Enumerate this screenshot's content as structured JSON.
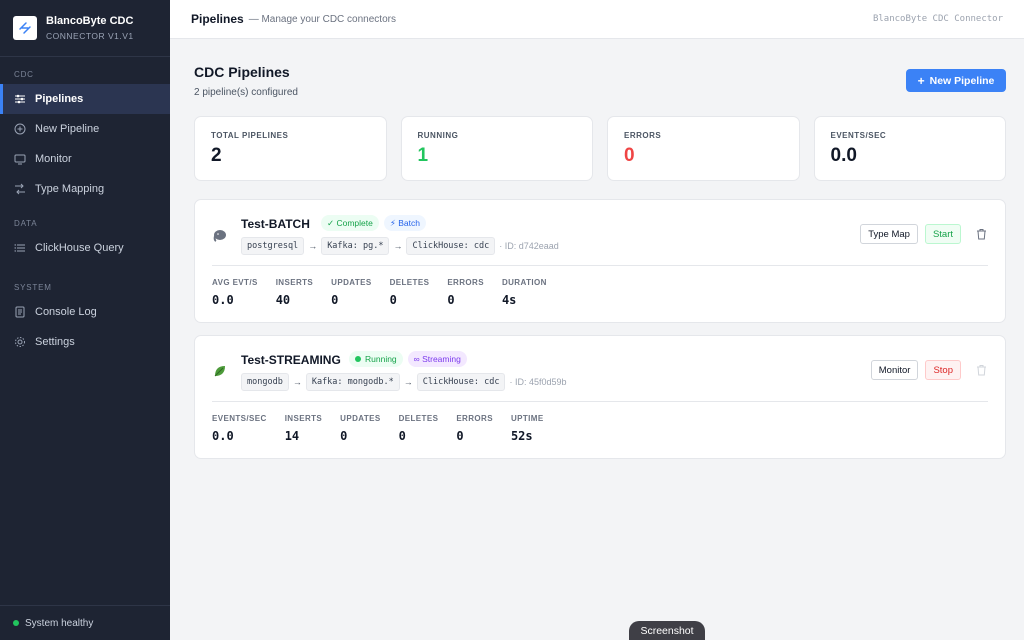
{
  "sidebar": {
    "brand_name": "BlancoByte CDC",
    "brand_version": "CONNECTOR V1.V1",
    "sections": [
      {
        "label": "CDC",
        "items": [
          {
            "label": "Pipelines",
            "icon": "sliders-icon"
          },
          {
            "label": "New Pipeline",
            "icon": "plus-circle-icon"
          },
          {
            "label": "Monitor",
            "icon": "monitor-icon"
          },
          {
            "label": "Type Mapping",
            "icon": "shuffle-icon"
          }
        ]
      },
      {
        "label": "DATA",
        "items": [
          {
            "label": "ClickHouse Query",
            "icon": "list-icon"
          }
        ]
      },
      {
        "label": "SYSTEM",
        "items": [
          {
            "label": "Console Log",
            "icon": "file-icon"
          },
          {
            "label": "Settings",
            "icon": "gear-icon"
          }
        ]
      }
    ],
    "status": "System healthy"
  },
  "topbar": {
    "title": "Pipelines",
    "subtitle": "— Manage your CDC connectors",
    "right": "BlancoByte CDC Connector"
  },
  "main": {
    "title": "CDC Pipelines",
    "subtitle": "2 pipeline(s) configured",
    "new_button": "New Pipeline",
    "stats": [
      {
        "label": "TOTAL PIPELINES",
        "value": "2",
        "color": "#111827"
      },
      {
        "label": "RUNNING",
        "value": "1",
        "color": "#22c55e"
      },
      {
        "label": "ERRORS",
        "value": "0",
        "color": "#ef4444"
      },
      {
        "label": "EVENTS/SEC",
        "value": "0.0",
        "color": "#111827"
      }
    ]
  },
  "pipelines": [
    {
      "name": "Test-BATCH",
      "icon": "elephant-icon",
      "badge_status": "✓ Complete",
      "badge_mode": "⚡ Batch",
      "source": "postgresql",
      "topic": "Kafka: pg.*",
      "sink": "ClickHouse: cdc",
      "id_text": "· ID: d742eaad",
      "btn_primary": "Type Map",
      "btn_secondary": "Start",
      "metrics": [
        {
          "label": "AVG EVT/S",
          "value": "0.0"
        },
        {
          "label": "INSERTS",
          "value": "40"
        },
        {
          "label": "UPDATES",
          "value": "0"
        },
        {
          "label": "DELETES",
          "value": "0"
        },
        {
          "label": "ERRORS",
          "value": "0"
        },
        {
          "label": "DURATION",
          "value": "4s"
        }
      ]
    },
    {
      "name": "Test-STREAMING",
      "icon": "leaf-icon",
      "badge_status": "Running",
      "badge_mode": "∞ Streaming",
      "source": "mongodb",
      "topic": "Kafka: mongodb.*",
      "sink": "ClickHouse: cdc",
      "id_text": "· ID: 45f0d59b",
      "btn_primary": "Monitor",
      "btn_secondary": "Stop",
      "metrics": [
        {
          "label": "EVENTS/SEC",
          "value": "0.0"
        },
        {
          "label": "INSERTS",
          "value": "14"
        },
        {
          "label": "UPDATES",
          "value": "0"
        },
        {
          "label": "DELETES",
          "value": "0"
        },
        {
          "label": "ERRORS",
          "value": "0"
        },
        {
          "label": "UPTIME",
          "value": "52s"
        }
      ]
    }
  ],
  "overlay": {
    "label": "Screenshot"
  },
  "colors": {
    "accent": "#3b82f6",
    "sidebar_bg": "#1e2433"
  }
}
